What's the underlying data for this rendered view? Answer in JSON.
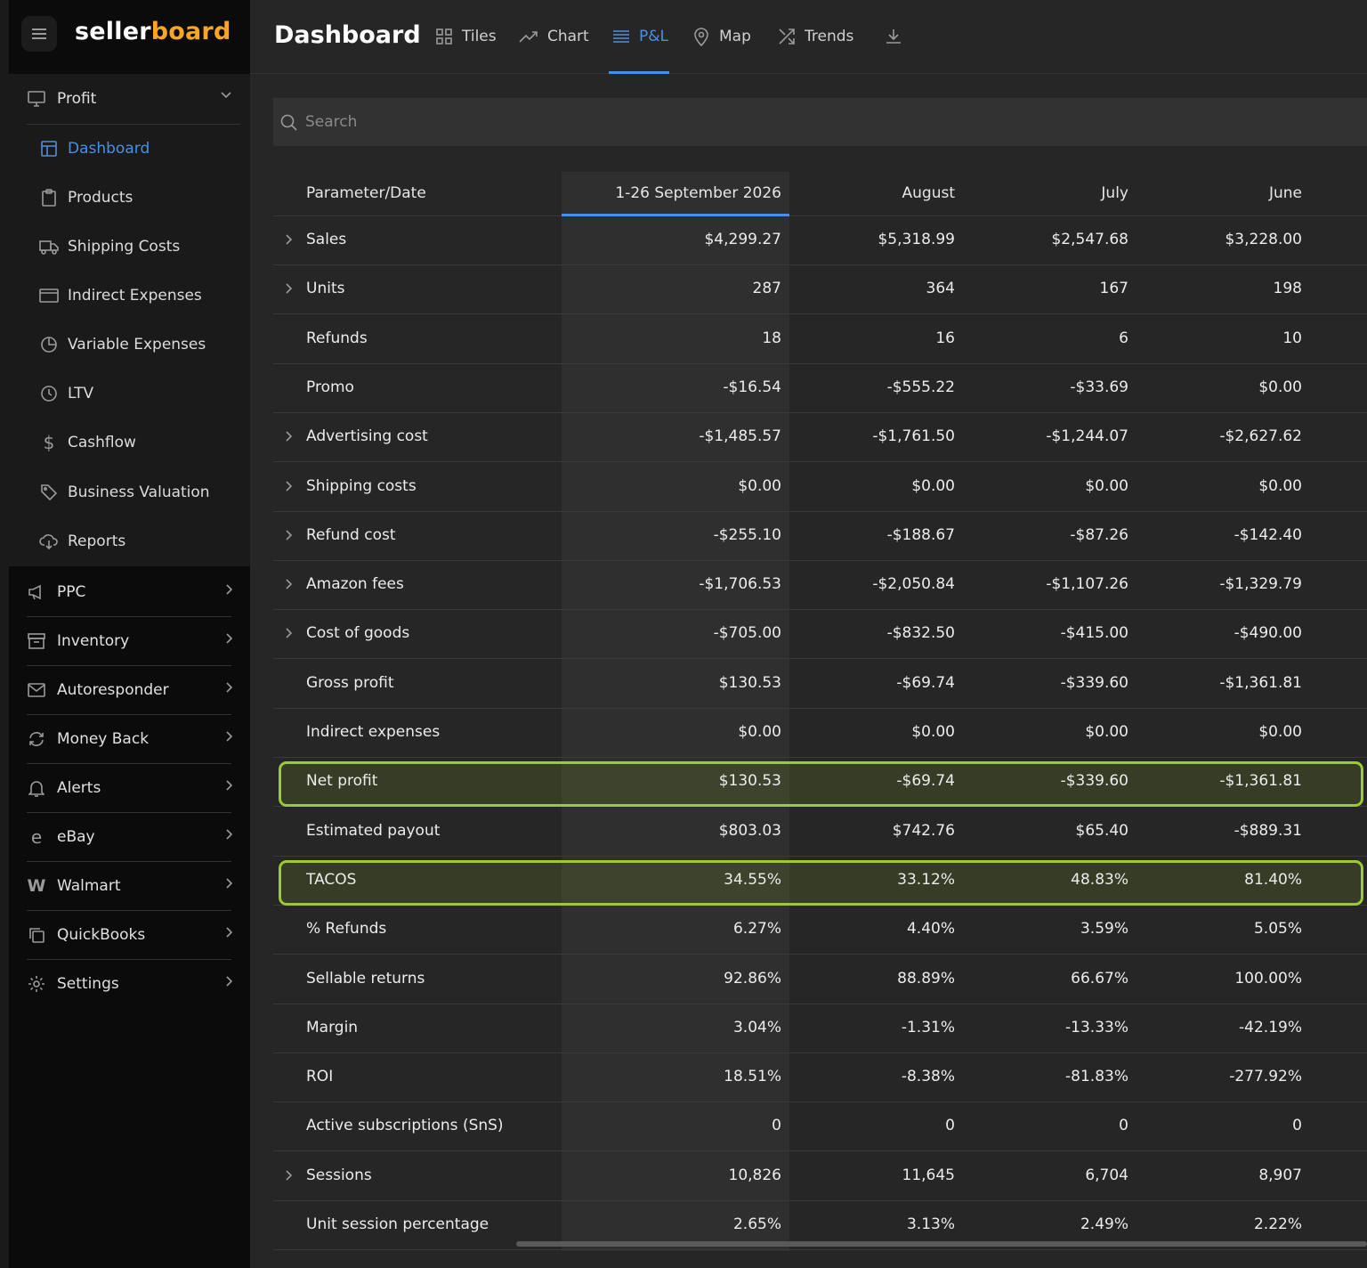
{
  "brand": {
    "part1": "seller",
    "part2": "board"
  },
  "sidebar": {
    "profit": {
      "label": "Profit",
      "items": [
        {
          "label": "Dashboard",
          "icon": "dashboard-icon"
        },
        {
          "label": "Products",
          "icon": "clipboard-icon"
        },
        {
          "label": "Shipping Costs",
          "icon": "truck-icon"
        },
        {
          "label": "Indirect Expenses",
          "icon": "card-icon"
        },
        {
          "label": "Variable Expenses",
          "icon": "pie-icon"
        },
        {
          "label": "LTV",
          "icon": "clock-icon"
        },
        {
          "label": "Cashflow",
          "icon": "dollar-icon"
        },
        {
          "label": "Business Valuation",
          "icon": "tag-icon"
        },
        {
          "label": "Reports",
          "icon": "cloud-download-icon"
        }
      ]
    },
    "main": [
      {
        "label": "PPC",
        "icon": "megaphone-icon"
      },
      {
        "label": "Inventory",
        "icon": "box-icon"
      },
      {
        "label": "Autoresponder",
        "icon": "mail-icon"
      },
      {
        "label": "Money Back",
        "icon": "refresh-icon"
      },
      {
        "label": "Alerts",
        "icon": "bell-icon"
      },
      {
        "label": "eBay",
        "icon": "ebay-icon"
      },
      {
        "label": "Walmart",
        "icon": "walmart-icon"
      },
      {
        "label": "QuickBooks",
        "icon": "copy-icon"
      },
      {
        "label": "Settings",
        "icon": "gear-icon"
      }
    ]
  },
  "header": {
    "title": "Dashboard",
    "tabs": [
      {
        "label": "Tiles"
      },
      {
        "label": "Chart"
      },
      {
        "label": "P&L"
      },
      {
        "label": "Map"
      },
      {
        "label": "Trends"
      }
    ]
  },
  "search": {
    "placeholder": "Search"
  },
  "table": {
    "columns": [
      "Parameter/Date",
      "1-26 September 2026",
      "August",
      "July",
      "June"
    ],
    "rows": [
      {
        "label": "Sales",
        "values": [
          "$4,299.27",
          "$5,318.99",
          "$2,547.68",
          "$3,228.00"
        ]
      },
      {
        "label": "Units",
        "values": [
          "287",
          "364",
          "167",
          "198"
        ]
      },
      {
        "label": "Refunds",
        "values": [
          "18",
          "16",
          "6",
          "10"
        ]
      },
      {
        "label": "Promo",
        "values": [
          "-$16.54",
          "-$555.22",
          "-$33.69",
          "$0.00"
        ]
      },
      {
        "label": "Advertising cost",
        "values": [
          "-$1,485.57",
          "-$1,761.50",
          "-$1,244.07",
          "-$2,627.62"
        ]
      },
      {
        "label": "Shipping costs",
        "values": [
          "$0.00",
          "$0.00",
          "$0.00",
          "$0.00"
        ]
      },
      {
        "label": "Refund cost",
        "values": [
          "-$255.10",
          "-$188.67",
          "-$87.26",
          "-$142.40"
        ]
      },
      {
        "label": "Amazon fees",
        "values": [
          "-$1,706.53",
          "-$2,050.84",
          "-$1,107.26",
          "-$1,329.79"
        ]
      },
      {
        "label": "Cost of goods",
        "values": [
          "-$705.00",
          "-$832.50",
          "-$415.00",
          "-$490.00"
        ]
      },
      {
        "label": "Gross profit",
        "values": [
          "$130.53",
          "-$69.74",
          "-$339.60",
          "-$1,361.81"
        ]
      },
      {
        "label": "Indirect expenses",
        "values": [
          "$0.00",
          "$0.00",
          "$0.00",
          "$0.00"
        ]
      },
      {
        "label": "Net profit",
        "values": [
          "$130.53",
          "-$69.74",
          "-$339.60",
          "-$1,361.81"
        ]
      },
      {
        "label": "Estimated payout",
        "values": [
          "$803.03",
          "$742.76",
          "$65.40",
          "-$889.31"
        ]
      },
      {
        "label": "TACOS",
        "values": [
          "34.55%",
          "33.12%",
          "48.83%",
          "81.40%"
        ]
      },
      {
        "label": "% Refunds",
        "values": [
          "6.27%",
          "4.40%",
          "3.59%",
          "5.05%"
        ]
      },
      {
        "label": "Sellable returns",
        "values": [
          "92.86%",
          "88.89%",
          "66.67%",
          "100.00%"
        ]
      },
      {
        "label": "Margin",
        "values": [
          "3.04%",
          "-1.31%",
          "-13.33%",
          "-42.19%"
        ]
      },
      {
        "label": "ROI",
        "values": [
          "18.51%",
          "-8.38%",
          "-81.83%",
          "-277.92%"
        ]
      },
      {
        "label": "Active subscriptions (SnS)",
        "values": [
          "0",
          "0",
          "0",
          "0"
        ]
      },
      {
        "label": "Sessions",
        "values": [
          "10,826",
          "11,645",
          "6,704",
          "8,907"
        ]
      },
      {
        "label": "Unit session percentage",
        "values": [
          "2.65%",
          "3.13%",
          "2.49%",
          "2.22%"
        ]
      }
    ]
  },
  "colors": {
    "accent": "#4a90e2",
    "brand": "#f5a623",
    "highlight": "#9cc93a"
  }
}
